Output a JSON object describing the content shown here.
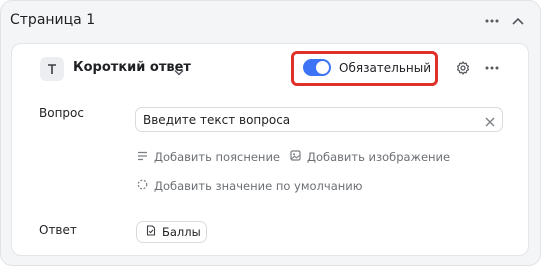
{
  "page": {
    "title": "Страница 1"
  },
  "question": {
    "type_label": "Короткий ответ",
    "required_label": "Обязательный",
    "required_on": true,
    "question_label": "Вопрос",
    "question_placeholder": "Введите текст вопроса",
    "add_description": "Добавить пояснение",
    "add_image": "Добавить изображение",
    "add_default": "Добавить значение по умолчанию",
    "answer_label": "Ответ",
    "score_button": "Баллы"
  },
  "colors": {
    "accent": "#3d74f5",
    "highlight": "#e0302a"
  }
}
